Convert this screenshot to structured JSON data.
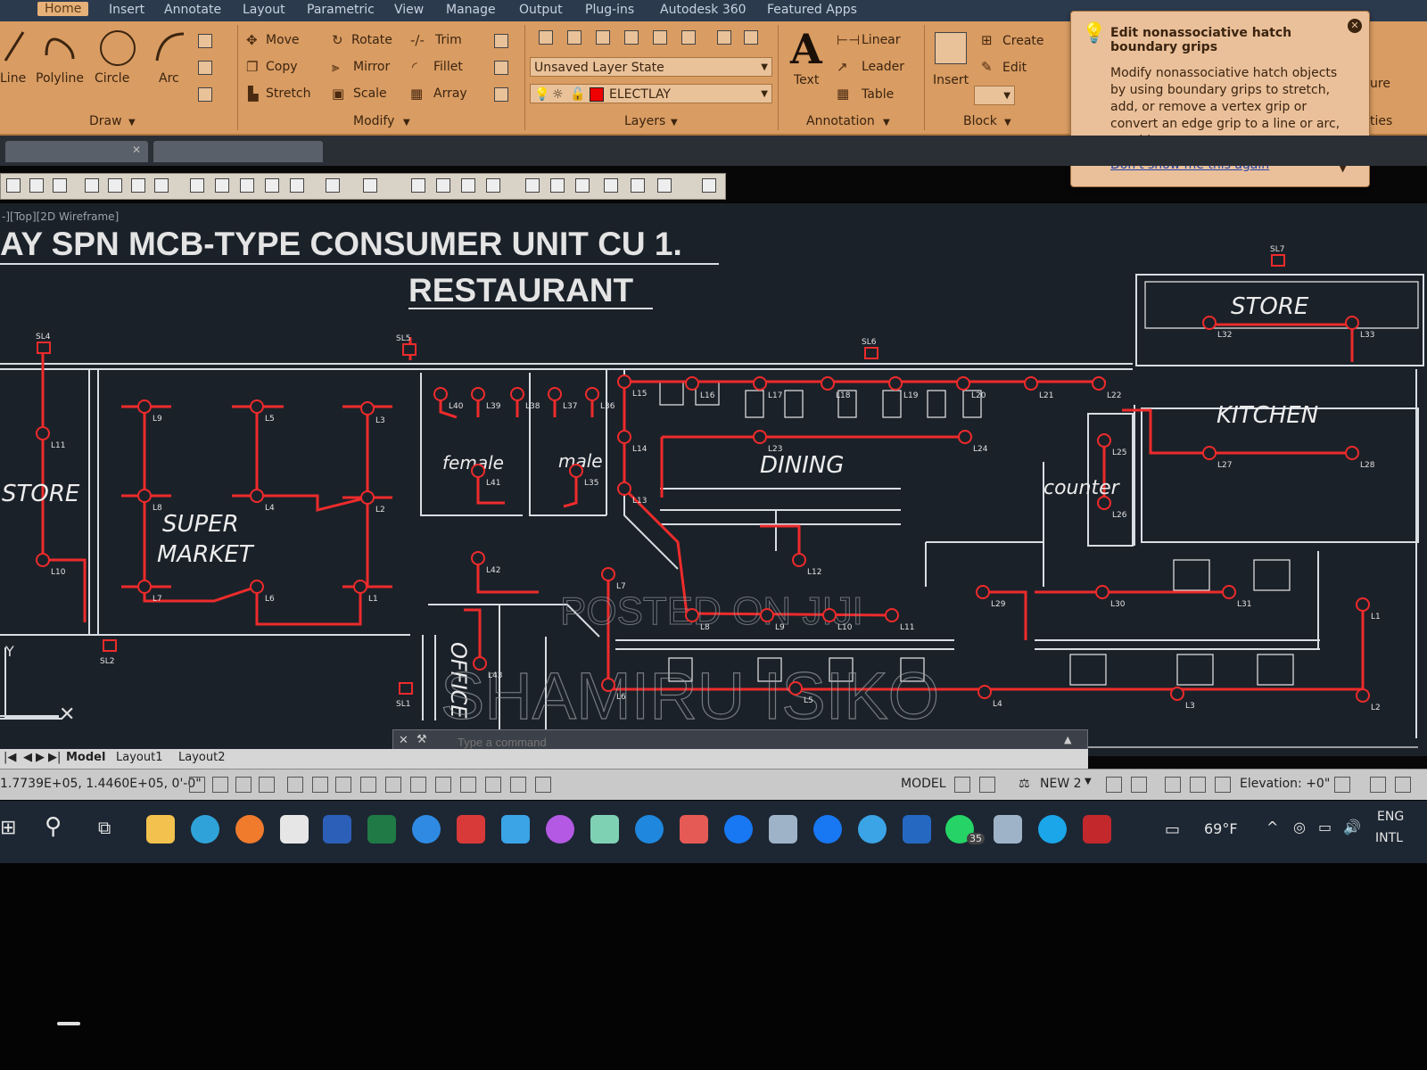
{
  "ribbon_tabs": [
    "Home",
    "Insert",
    "Annotate",
    "Layout",
    "Parametric",
    "View",
    "Manage",
    "Output",
    "Plug-ins",
    "Autodesk 360",
    "Featured Apps"
  ],
  "draw_group": {
    "label": "Draw",
    "tools": [
      "Line",
      "Polyline",
      "Circle",
      "Arc"
    ]
  },
  "modify_group": {
    "label": "Modify",
    "tools": [
      "Move",
      "Rotate",
      "Trim",
      "Copy",
      "Mirror",
      "Fillet",
      "Stretch",
      "Scale",
      "Array"
    ]
  },
  "layers_group": {
    "label": "Layers",
    "layer_state": "Unsaved Layer State",
    "current_layer": "ELECTLAY"
  },
  "annotation_group": {
    "label": "Annotation",
    "tools": [
      "Text",
      "Linear",
      "Leader",
      "Table"
    ]
  },
  "block_group": {
    "label": "Block",
    "tools": [
      "Insert",
      "Create",
      "Edit"
    ]
  },
  "properties_group": {
    "label": "ties",
    "match_label": "ure"
  },
  "tooltip": {
    "title": "Edit nonassociative hatch boundary grips",
    "body": "Modify nonassociative hatch objects by using boundary grips to stretch, add, or remove a vertex grip or convert an edge grip to a line or arc, or add a vertex.",
    "link": "Don't show me this again"
  },
  "viewport_label": "-][Top][2D Wireframe]",
  "drawing": {
    "title_line1": "AY SPN MCB-TYPE CONSUMER UNIT CU 1.",
    "title_line2": "RESTAURANT",
    "rooms": {
      "store_left": "STORE",
      "supermarket1": "SUPER",
      "supermarket2": "MARKET",
      "female": "female",
      "male": "male",
      "dining": "DINING",
      "counter": "counter",
      "kitchen": "KITCHEN",
      "store_right": "STORE",
      "office": "OFFICE"
    },
    "watermark1": "POSTED ON JIJI",
    "watermark2": "SHAMIRU ISIKO",
    "switch_labels": [
      "SL4",
      "SL5",
      "SL6",
      "SL7",
      "SL2",
      "SL1"
    ],
    "light_labels": [
      "L11",
      "L10",
      "L9",
      "L8",
      "L7",
      "L5",
      "L4",
      "L6",
      "L3",
      "L2",
      "L1",
      "L40",
      "L39",
      "L38",
      "L37",
      "L36",
      "L41",
      "L35",
      "L15",
      "L14",
      "L13",
      "L16",
      "L17",
      "L18",
      "L19",
      "L20",
      "L21",
      "L22",
      "L23",
      "L24",
      "L25",
      "L26",
      "L27",
      "L28",
      "L32",
      "L33",
      "L12",
      "L42",
      "L43",
      "L29",
      "L30",
      "L31",
      "L9",
      "L10",
      "L11",
      "L8",
      "L4",
      "L3",
      "L2",
      "L1",
      "L5",
      "L6",
      "L7"
    ]
  },
  "command_line": {
    "placeholder": "Type a command"
  },
  "layout_tabs": [
    "Model",
    "Layout1",
    "Layout2"
  ],
  "status_bar": {
    "coords": "1.7739E+05, 1.4460E+05, 0'-0\"",
    "model": "MODEL",
    "annot_scale": "NEW 2",
    "elevation": "Elevation: +0\""
  },
  "taskbar": {
    "weather": "69°F",
    "lang1": "ENG",
    "lang2": "INTL",
    "whatsapp_badge": "35",
    "apps": [
      "start",
      "search",
      "task-view",
      "file-explorer",
      "edge",
      "firefox",
      "store",
      "word",
      "excel",
      "zoom",
      "pdf",
      "mail",
      "messenger",
      "notepad",
      "imo",
      "video",
      "facebook",
      "keyboard",
      "facebook-2",
      "remote",
      "rdp",
      "whatsapp",
      "calculator",
      "c-app",
      "autocad"
    ]
  }
}
